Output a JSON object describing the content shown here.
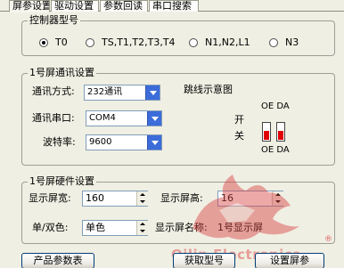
{
  "tabs": [
    "屏参设置",
    "驱动设置",
    "参数回读",
    "串口搜索"
  ],
  "controller_group": {
    "title": "控制器型号",
    "options": [
      "T0",
      "TS,T1,T2,T3,T4",
      "N1,N2,L1",
      "N3"
    ],
    "selected_index": 0
  },
  "comm_group": {
    "title": "1号屏通讯设置",
    "method_label": "通讯方式:",
    "method_value": "232通讯",
    "port_label": "通讯串口:",
    "port_value": "COM4",
    "baud_label": "波特率:",
    "baud_value": "9600",
    "jumper_title": "跳线示意图",
    "switch_label_1": "开",
    "switch_label_2": "关",
    "dip_top_labels": "OE DA",
    "dip_bottom_labels": "OE DA"
  },
  "hardware_group": {
    "title": "1号屏硬件设置",
    "width_label": "显示屏宽:",
    "width_value": "160",
    "height_label": "显示屏高:",
    "height_value": "16",
    "color_label": "单/双色:",
    "color_value": "单色",
    "name_label": "显示屏名称:",
    "name_value": "1号显示屏"
  },
  "buttons": {
    "product_params": "产品参数表",
    "get_model": "获取型号",
    "set_screen": "设置屏参"
  },
  "watermark": {
    "text": "Qilin Electronics",
    "registered": "®"
  },
  "colors": {
    "accent_blue": "#3b6cd9",
    "dip_red": "#e00000",
    "watermark_red": "#e05a5a"
  }
}
